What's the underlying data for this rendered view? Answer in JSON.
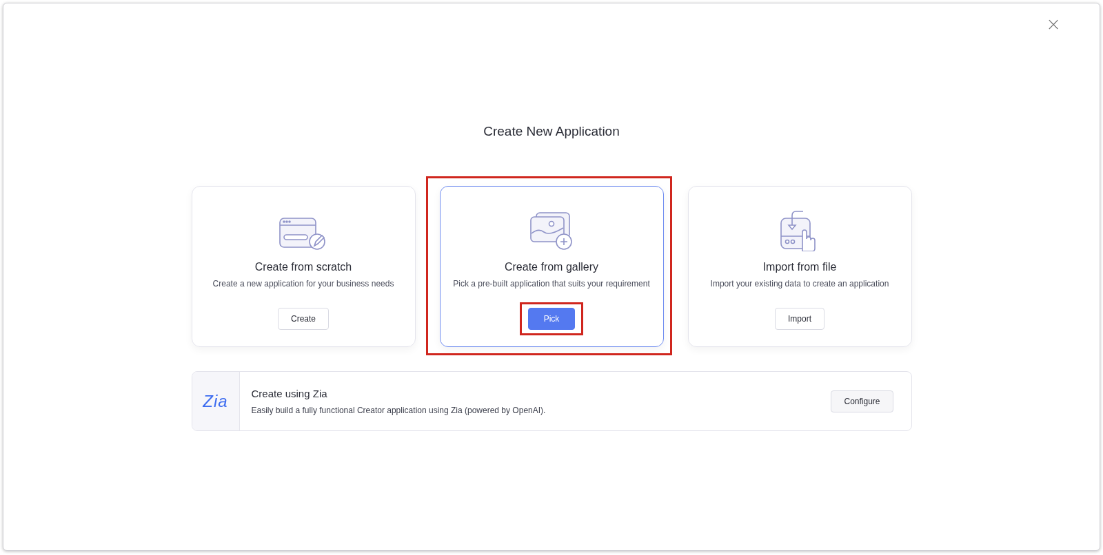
{
  "dialog": {
    "title": "Create New Application",
    "close_label": "×"
  },
  "cards": [
    {
      "kind": "scratch",
      "title": "Create from scratch",
      "description": "Create a new application for your business needs",
      "button": "Create",
      "selected": false,
      "highlighted": false,
      "button_highlighted": false
    },
    {
      "kind": "gallery",
      "title": "Create from gallery",
      "description": "Pick a pre-built application that suits your requirement",
      "button": "Pick",
      "selected": true,
      "highlighted": true,
      "button_highlighted": true
    },
    {
      "kind": "import",
      "title": "Import from file",
      "description": "Import your existing data to create an application",
      "button": "Import",
      "selected": false,
      "highlighted": false,
      "button_highlighted": false
    }
  ],
  "zia": {
    "logo_text": "Zia",
    "title": "Create using Zia",
    "description": "Easily build a fully functional Creator application using Zia (powered by OpenAI).",
    "button": "Configure"
  }
}
